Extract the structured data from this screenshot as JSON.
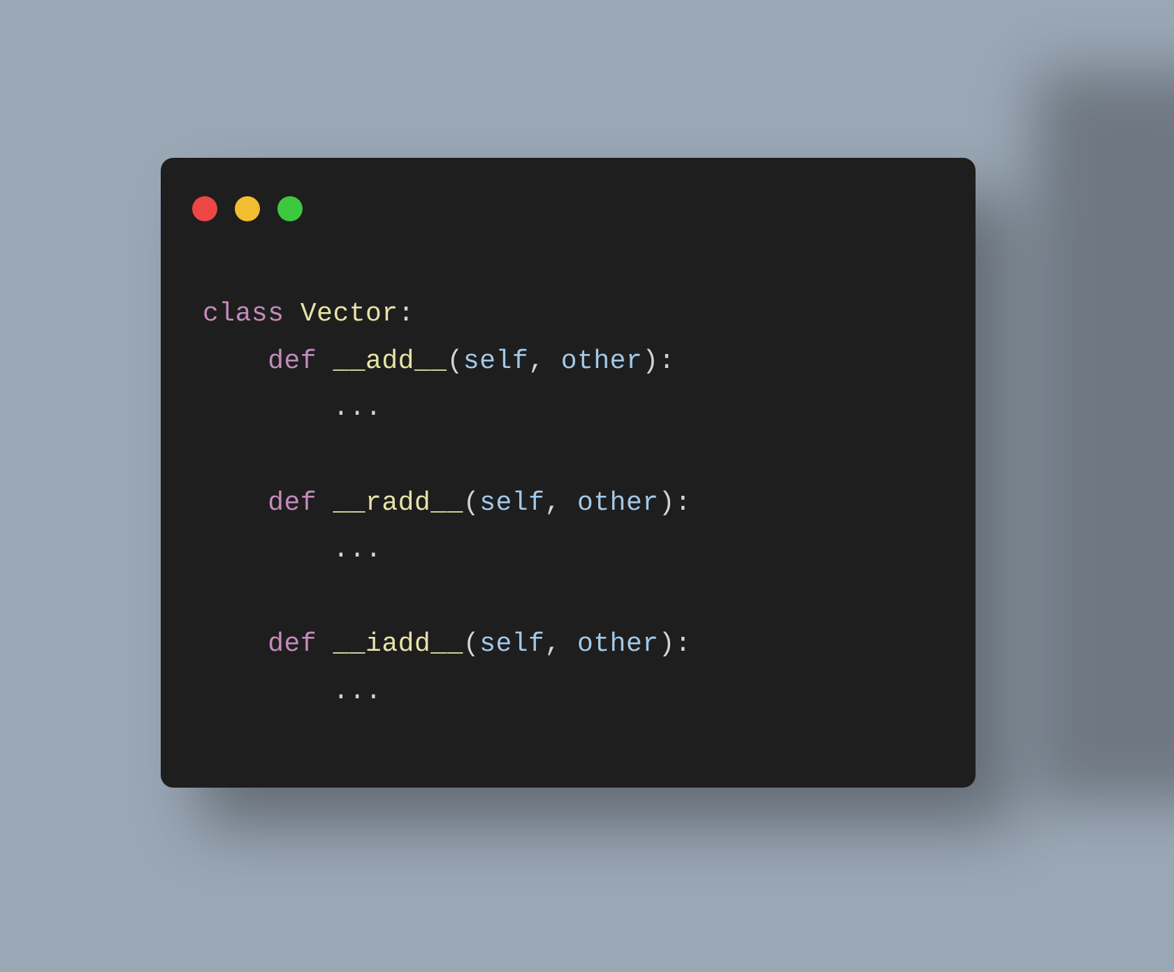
{
  "code": {
    "line1": {
      "kw_class": "class",
      "sp1": " ",
      "classname": "Vector",
      "colon": ":"
    },
    "method1": {
      "indent": "    ",
      "kw_def": "def",
      "sp": " ",
      "name": "__add__",
      "open": "(",
      "p1": "self",
      "comma": ", ",
      "p2": "other",
      "close": ")",
      "colon": ":",
      "body_indent": "        ",
      "body": "..."
    },
    "method2": {
      "indent": "    ",
      "kw_def": "def",
      "sp": " ",
      "name": "__radd__",
      "open": "(",
      "p1": "self",
      "comma": ", ",
      "p2": "other",
      "close": ")",
      "colon": ":",
      "body_indent": "        ",
      "body": "..."
    },
    "method3": {
      "indent": "    ",
      "kw_def": "def",
      "sp": " ",
      "name": "__iadd__",
      "open": "(",
      "p1": "self",
      "comma": ", ",
      "p2": "other",
      "close": ")",
      "colon": ":",
      "body_indent": "        ",
      "body": "..."
    }
  },
  "colors": {
    "bg": "#9aa7b5",
    "window": "#1f1e1e",
    "red": "#ec4645",
    "yellow": "#f2be31",
    "green": "#3cc93f",
    "keyword": "#c38bbd",
    "classname": "#e6e3a8",
    "funcname": "#e6e3a8",
    "param": "#a1c9e8",
    "default": "#d4d4d4"
  }
}
